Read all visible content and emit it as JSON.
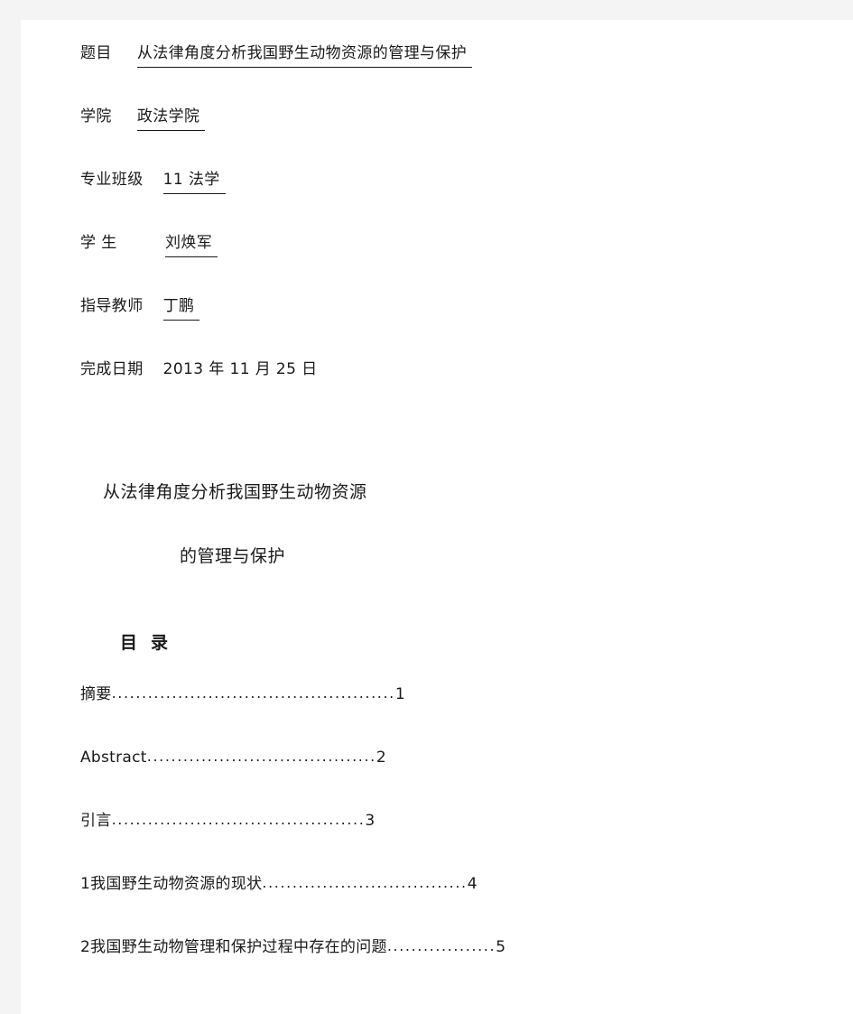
{
  "document": {
    "cover": {
      "fields": [
        {
          "label": "题目",
          "label_style": "plain",
          "gap": "sm",
          "value": "从法律角度分析我国野生动物资源的管理与保护",
          "underlined": true
        },
        {
          "label": "学院",
          "label_style": "plain",
          "gap": "sm",
          "value": "政法学院",
          "underlined": true
        },
        {
          "label": "专业班级",
          "label_style": "plain",
          "gap": "md",
          "value": "11 法学",
          "underlined": true
        },
        {
          "label": "学 生",
          "label_style": "wide",
          "gap": "md",
          "value": "刘焕军",
          "underlined": true
        },
        {
          "label": "指导教师",
          "label_style": "plain",
          "gap": "md",
          "value": "丁鹏",
          "underlined": true
        },
        {
          "label": "完成日期",
          "label_style": "plain",
          "gap": "md",
          "value": "2013 年 11 月 25 日",
          "underlined": false
        }
      ]
    },
    "title_block": {
      "line1": "从法律角度分析我国野生动物资源",
      "line2": "的管理与保护"
    },
    "toc": {
      "heading_char1": "目",
      "heading_char2": "录",
      "entries": [
        {
          "indent": "  ",
          "label": "摘要",
          "leader": "...............................................",
          "page": " 1"
        },
        {
          "indent": "",
          "label": "Abstract",
          "leader": "......................................",
          "page": "2"
        },
        {
          "indent": "  ",
          "label": "引言",
          "leader": "..........................................",
          "page": "3"
        },
        {
          "indent": "",
          "label": "1我国野生动物资源的现状",
          "leader": "..................................",
          "page": "4"
        },
        {
          "indent": "",
          "label": "2我国野生动物管理和保护过程中存在的问题",
          "leader": "..................",
          "page": "5"
        }
      ]
    }
  }
}
